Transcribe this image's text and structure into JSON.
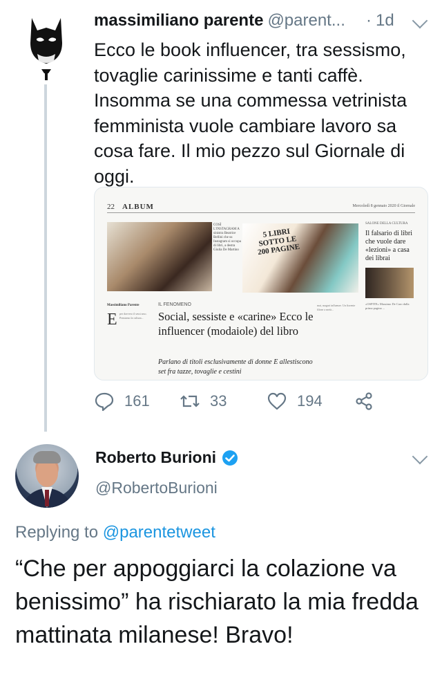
{
  "tweet1": {
    "name": "massimiliano parente",
    "handle": "@parent...",
    "dot": "·",
    "time": "1d",
    "text": "Ecco le book influencer, tra sessismo, tovaglie carinissime e tanti caffè. Insomma se una commessa vetrinista femminista vuole cambiare lavoro sa cosa fare. Il mio pezzo sul Giornale di oggi.",
    "avatar_icon": "batman-mask-icon",
    "media": {
      "page_number": "22",
      "section": "ALBUM",
      "date": "Mercoledì 8 gennaio 2020   il Giornale",
      "photo_text": "5 LIBRI SOTTO LE 200 PAGINE",
      "caption": "COSÌ L'INSTAGRAM A sinistra Beatrice Bellini che su Instagram si occupa di libri, a destra Giulia De Martino",
      "side_kicker": "SALONE DELLA CULTURA",
      "side_title": "Il falsario di libri che vuole dare «lezioni» a casa dei librai",
      "side_body": "«OSPITE» Massimo De Caro dalla prima pagina ...",
      "byline": "Massimiliano Parente",
      "kicker": "IL FENOMENO",
      "dropcap": "E",
      "col1": "per davvero il sessi smo. Pensiamo la cultura...",
      "headline": "Social, sessiste e «carine» Ecco le influencer (modaiole) del libro",
      "deck": "Parlano di titoli esclusivamente di donne E allestiscono set fra tazze, tovaglie e cestini",
      "col2": "mai, magari influenze. Un fiorente filone a metà..."
    },
    "actions": {
      "reply_count": "161",
      "retweet_count": "33",
      "like_count": "194"
    }
  },
  "tweet2": {
    "name": "Roberto Burioni",
    "handle": "@RobertoBurioni",
    "replying_label": "Replying to",
    "replying_to": "@parentetweet",
    "text": "“Che per appoggiarci la colazione va benissimo” ha rischiarato la mia fredda mattinata milanese! Bravo!"
  },
  "colors": {
    "text": "#14171a",
    "secondary": "#657786",
    "link": "#1b95e0",
    "thread_line": "#cdd6dd"
  }
}
